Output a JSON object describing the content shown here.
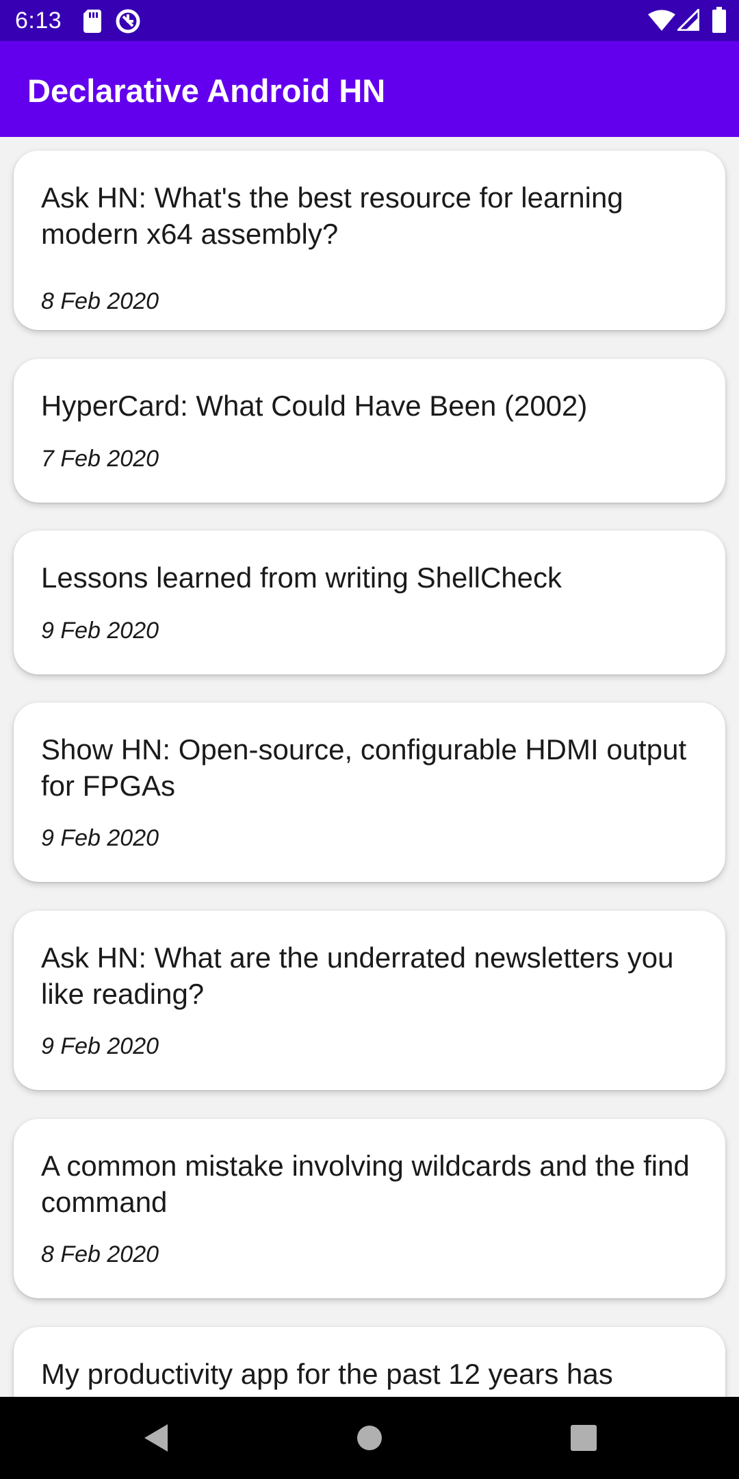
{
  "status_bar": {
    "time": "6:13",
    "icons": [
      "sd-card-icon",
      "sync-circle-icon",
      "wifi-icon",
      "signal-icon",
      "battery-icon"
    ]
  },
  "app_bar": {
    "title": "Declarative Android HN",
    "background": "#6200ee",
    "status_bar_background": "#3700b3"
  },
  "stories": [
    {
      "title": "Ask HN: What's the best resource for learning modern x64 assembly?",
      "date": "8 Feb 2020"
    },
    {
      "title": "HyperCard: What Could Have Been (2002)",
      "date": "7 Feb 2020"
    },
    {
      "title": "Lessons learned from writing ShellCheck",
      "date": "9 Feb 2020"
    },
    {
      "title": "Show HN: Open-source, configurable HDMI output for FPGAs",
      "date": "9 Feb 2020"
    },
    {
      "title": "Ask HN: What are the underrated newsletters you like reading?",
      "date": "9 Feb 2020"
    },
    {
      "title": "A common mistake involving wildcards and the find command",
      "date": "8 Feb 2020"
    },
    {
      "title": "My productivity app for the past 12 years has",
      "date": ""
    }
  ],
  "nav_bar": {
    "buttons": [
      "back-icon",
      "home-icon",
      "recents-icon"
    ]
  }
}
